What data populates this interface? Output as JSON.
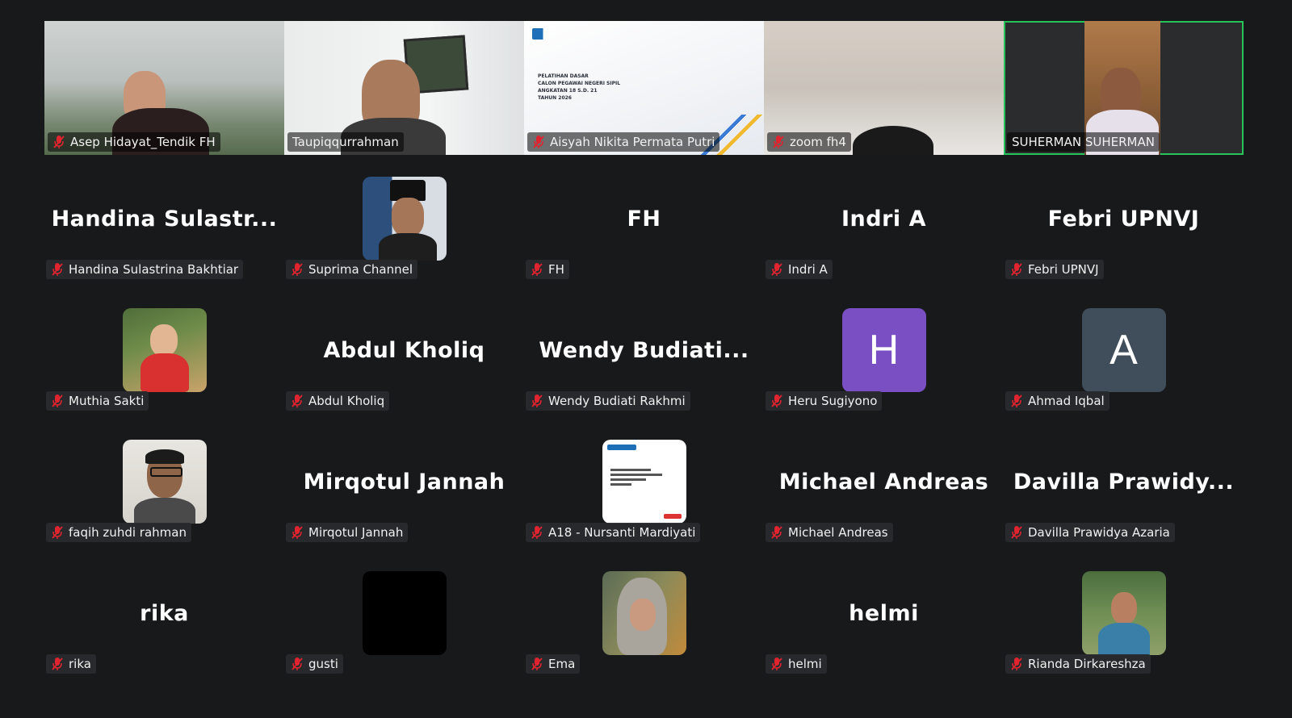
{
  "video_row": [
    {
      "name": "Asep Hidayat_Tendik FH",
      "muted": true
    },
    {
      "name": "Taupiqqurrahman",
      "muted": false
    },
    {
      "name": "Aisyah Nikita Permata Putri",
      "muted": true,
      "slide_lines": [
        "PELATIHAN DASAR",
        "CALON PEGAWAI NEGERI SIPIL",
        "ANGKATAN 18 S.D. 21",
        "TAHUN 2026"
      ]
    },
    {
      "name": "zoom fh4",
      "muted": true
    },
    {
      "name": "SUHERMAN SUHERMAN",
      "muted": false,
      "active_speaker": true
    }
  ],
  "participants": [
    {
      "display": "Handina  Sulastr...",
      "name": "Handina Sulastrina Bakhtiar",
      "type": "text"
    },
    {
      "name": "Suprima Channel",
      "type": "photo",
      "photo": "man-peci"
    },
    {
      "display": "FH",
      "name": "FH",
      "type": "text"
    },
    {
      "display": "Indri A",
      "name": "Indri A",
      "type": "text"
    },
    {
      "display": "Febri UPNVJ",
      "name": "Febri UPNVJ",
      "type": "text"
    },
    {
      "name": "Muthia Sakti",
      "type": "photo",
      "photo": "child"
    },
    {
      "display": "Abdul Kholiq",
      "name": "Abdul Kholiq",
      "type": "text"
    },
    {
      "display": "Wendy  Budiati...",
      "name": "Wendy Budiati Rakhmi",
      "type": "text"
    },
    {
      "letter": "H",
      "name": "Heru Sugiyono",
      "type": "letter",
      "color": "#7b4fc4"
    },
    {
      "letter": "A",
      "name": "Ahmad Iqbal",
      "type": "letter",
      "color": "#3f4e5a"
    },
    {
      "name": "faqih zuhdi rahman",
      "type": "photo",
      "photo": "man-glasses"
    },
    {
      "display": "Mirqotul Jannah",
      "name": "Mirqotul Jannah",
      "type": "text"
    },
    {
      "name": "A18 - Nursanti Mardiyati",
      "type": "photo",
      "photo": "slide"
    },
    {
      "display": "Michael Andreas",
      "name": "Michael Andreas",
      "type": "text"
    },
    {
      "display": "Davilla  Prawidy...",
      "name": "Davilla Prawidya Azaria",
      "type": "text"
    },
    {
      "display": "rika",
      "name": "rika",
      "type": "text"
    },
    {
      "name": "gusti",
      "type": "photo",
      "photo": "black"
    },
    {
      "name": "Ema",
      "type": "photo",
      "photo": "hijab"
    },
    {
      "display": "helmi",
      "name": "helmi",
      "type": "text"
    },
    {
      "name": "Rianda Dirkareshza",
      "type": "photo",
      "photo": "man-batik"
    }
  ],
  "colors": {
    "background": "#17191b",
    "active_border": "#27c45a",
    "muted_icon": "#e0242f"
  }
}
